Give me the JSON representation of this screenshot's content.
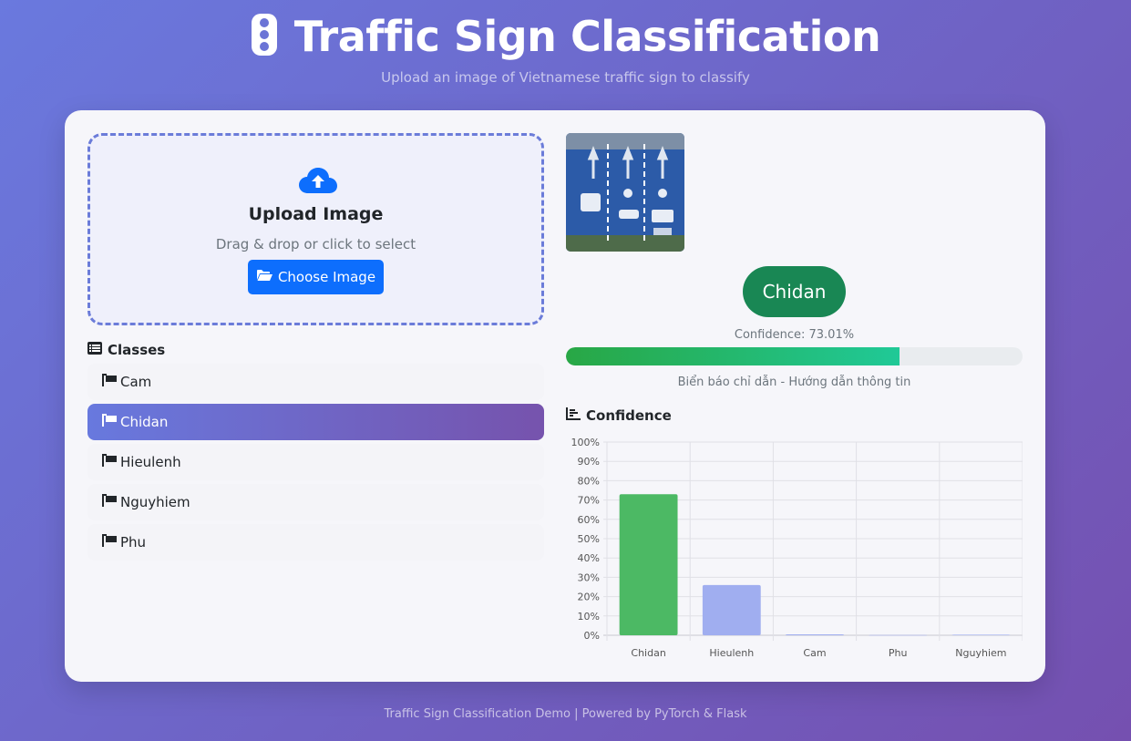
{
  "header": {
    "title": "Traffic Sign Classification",
    "subtitle": "Upload an image of Vietnamese traffic sign to classify"
  },
  "upload": {
    "title": "Upload Image",
    "hint": "Drag & drop or click to select",
    "button_label": "Choose Image"
  },
  "classes": {
    "title": "Classes",
    "items": [
      {
        "label": "Cam",
        "active": false
      },
      {
        "label": "Chidan",
        "active": true
      },
      {
        "label": "Hieulenh",
        "active": false
      },
      {
        "label": "Nguyhiem",
        "active": false
      },
      {
        "label": "Phu",
        "active": false
      }
    ]
  },
  "result": {
    "prediction": "Chidan",
    "confidence_text": "Confidence: 73.01%",
    "confidence_value": 73.01,
    "description": "Biển báo chỉ dẫn - Hướng dẫn thông tin"
  },
  "confidence_section": {
    "title": "Confidence"
  },
  "chart_data": {
    "type": "bar",
    "categories": [
      "Chidan",
      "Hieulenh",
      "Cam",
      "Phu",
      "Nguyhiem"
    ],
    "values": [
      73.01,
      26.0,
      0.5,
      0.1,
      0.3
    ],
    "colors": [
      "#4cb964",
      "#a0aef0",
      "#a0aef0",
      "#a0aef0",
      "#a0aef0"
    ],
    "y_ticks": [
      "0%",
      "10%",
      "20%",
      "30%",
      "40%",
      "50%",
      "60%",
      "70%",
      "80%",
      "90%",
      "100%"
    ],
    "ylim": [
      0,
      100
    ],
    "grid": true
  },
  "footer": {
    "text": "Traffic Sign Classification Demo | Powered by PyTorch & Flask"
  },
  "colors": {
    "primary": "#0d6efd",
    "success": "#198754",
    "accent_start": "#6879de",
    "accent_end": "#7653ad"
  }
}
